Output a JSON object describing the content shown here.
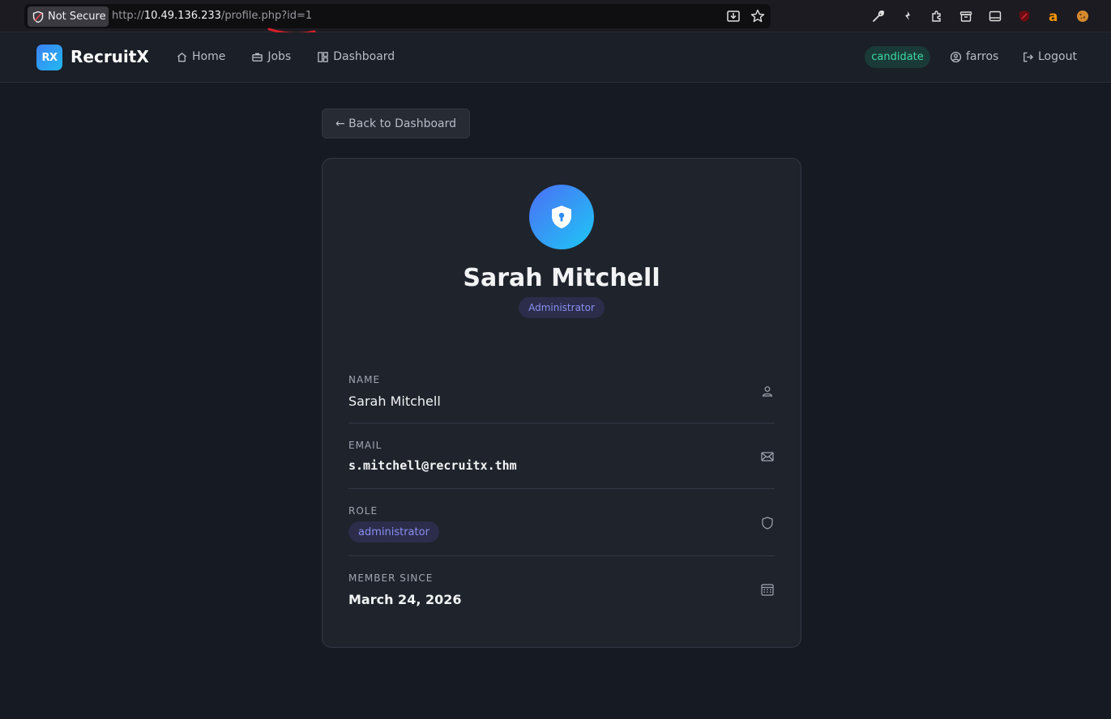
{
  "browser": {
    "security_label": "Not Secure",
    "url_scheme": "http://",
    "url_host": "10.49.136.233",
    "url_path": "/profile.php?id=1"
  },
  "nav": {
    "logo": "RX",
    "brand": "RecruitX",
    "links": [
      {
        "label": "Home",
        "icon": "home-icon"
      },
      {
        "label": "Jobs",
        "icon": "briefcase-icon"
      },
      {
        "label": "Dashboard",
        "icon": "dashboard-icon"
      }
    ],
    "user_role": "candidate",
    "username": "farros",
    "logout": "Logout"
  },
  "back_button": "← Back to Dashboard",
  "profile": {
    "name": "Sarah Mitchell",
    "role_badge": "Administrator",
    "fields": {
      "name_label": "NAME",
      "name_value": "Sarah Mitchell",
      "email_label": "EMAIL",
      "email_value": "s.mitchell@recruitx.thm",
      "role_label": "ROLE",
      "role_value": "administrator",
      "member_label": "MEMBER SINCE",
      "member_value": "March 24, 2026"
    }
  },
  "colors": {
    "background": "#161a22",
    "card": "#1f232c",
    "accent": "#3b82f6",
    "candidate_pill": "#3fd8a4",
    "admin_badge": "#8b8ff0"
  }
}
